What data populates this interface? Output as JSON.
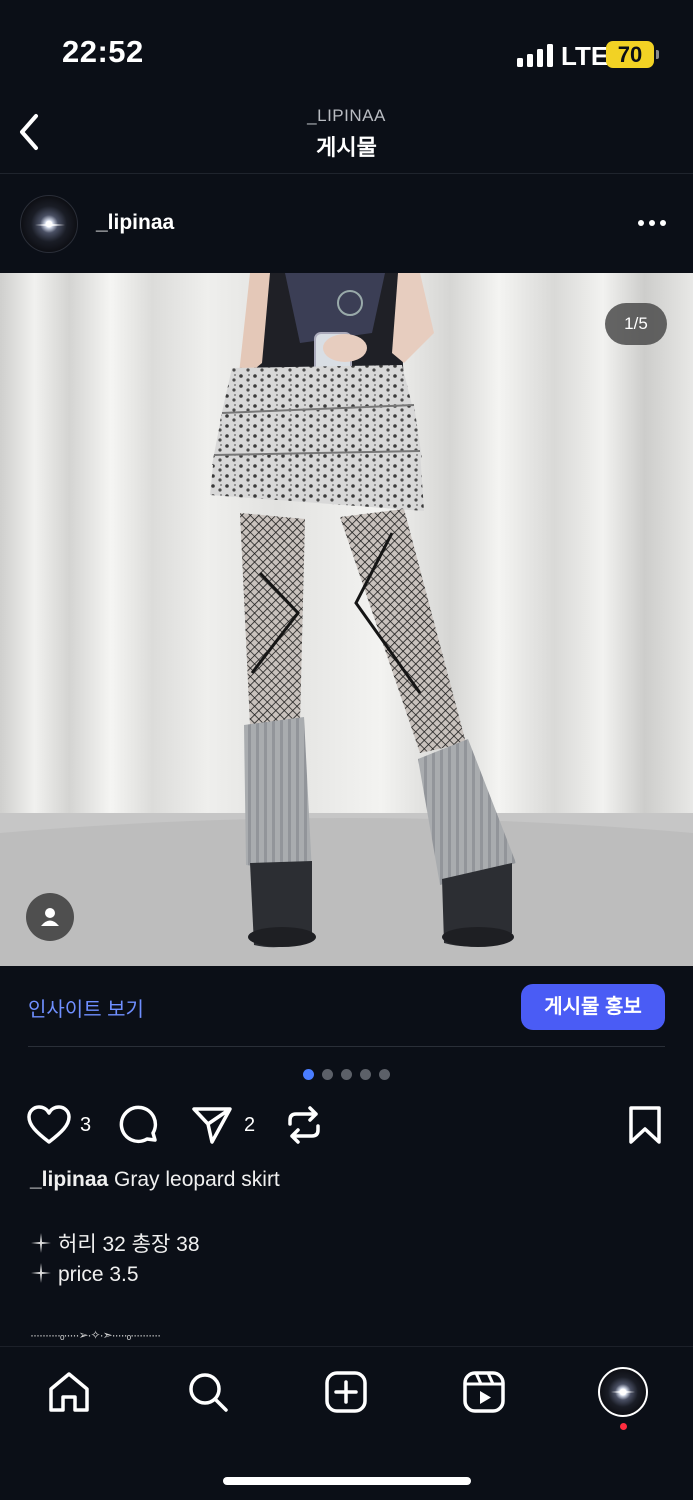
{
  "status_bar": {
    "time": "22:52",
    "network": "LTE",
    "battery": "70"
  },
  "header": {
    "subtitle": "_LIPINAA",
    "title": "게시물"
  },
  "post": {
    "username": "_lipinaa",
    "photo_counter": "1/5",
    "current_photo_index": 1,
    "total_photos": 5
  },
  "insights": {
    "link_label": "인사이트 보기",
    "promote_label": "게시물 홍보"
  },
  "actions": {
    "likes": "3",
    "shares": "2"
  },
  "caption": {
    "username": "_lipinaa",
    "text": "Gray leopard skirt",
    "lines": [
      "허리 32 총장 38",
      "price 3.5"
    ],
    "ornament": "··········ₒ·····➢·✧·➣·····ₒ··········"
  },
  "colors": {
    "background": "#0b0f17",
    "accent_blue": "#4a5cf5",
    "link_blue": "#6f8fff",
    "battery_yellow": "#f2d224",
    "notification_red": "#ff2d3f"
  },
  "icons": [
    "back-icon",
    "more-icon",
    "person-tag-icon",
    "heart-icon",
    "comment-icon",
    "share-icon",
    "repost-icon",
    "bookmark-icon",
    "home-icon",
    "search-icon",
    "create-icon",
    "reels-icon"
  ]
}
